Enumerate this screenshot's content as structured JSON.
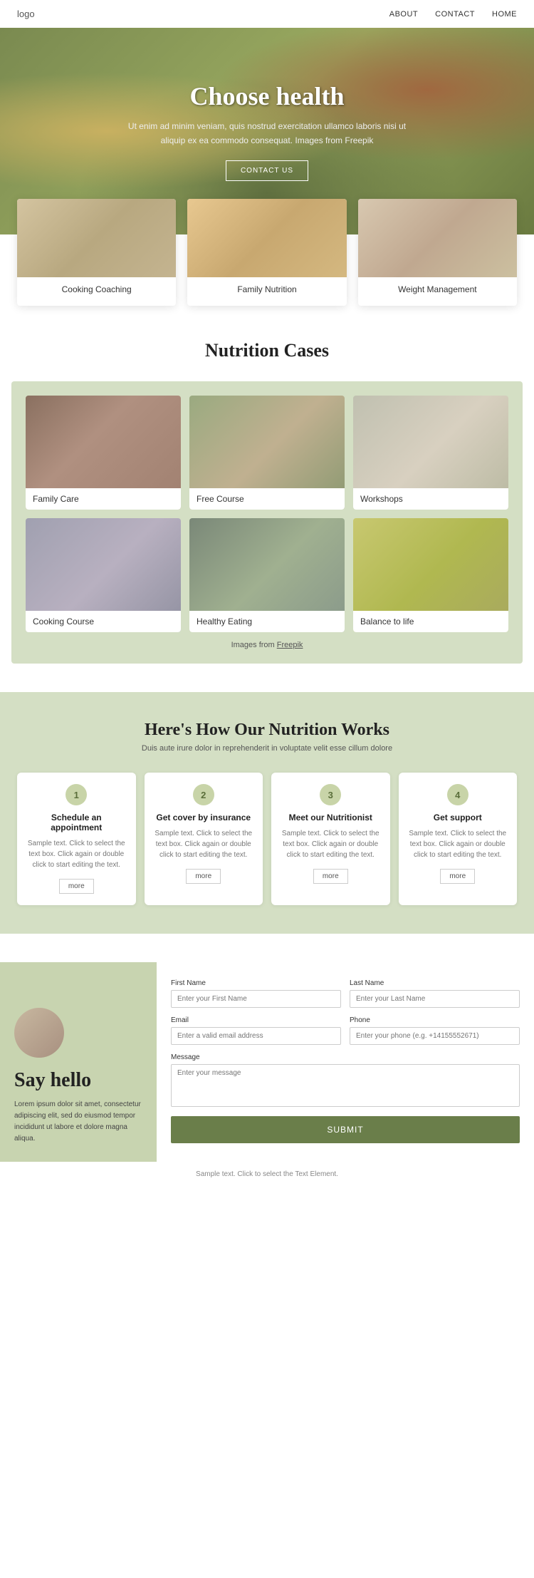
{
  "nav": {
    "logo": "logo",
    "links": [
      "ABOUT",
      "CONTACT",
      "HOME"
    ]
  },
  "hero": {
    "title": "Choose health",
    "description": "Ut enim ad minim veniam, quis nostrud exercitation ullamco laboris nisi ut aliquip ex ea commodo consequat. Images from Freepik",
    "cta_label": "CONTACT US"
  },
  "services": [
    {
      "label": "Cooking Coaching"
    },
    {
      "label": "Family Nutrition"
    },
    {
      "label": "Weight Management"
    }
  ],
  "nutrition": {
    "title": "Nutrition Cases",
    "cases": [
      {
        "label": "Family Care"
      },
      {
        "label": "Free Course"
      },
      {
        "label": "Workshops"
      },
      {
        "label": "Cooking Course"
      },
      {
        "label": "Healthy Eating"
      },
      {
        "label": "Balance to life"
      }
    ],
    "freepik_text": "Images from ",
    "freepik_link": "Freepik"
  },
  "how": {
    "title": "Here's How Our Nutrition Works",
    "subtitle": "Duis aute irure dolor in reprehenderit in voluptate velit esse cillum dolore",
    "steps": [
      {
        "num": "1",
        "title": "Schedule an appointment",
        "text": "Sample text. Click to select the text box. Click again or double click to start editing the text.",
        "more": "more"
      },
      {
        "num": "2",
        "title": "Get cover by insurance",
        "text": "Sample text. Click to select the text box. Click again or double click to start editing the text.",
        "more": "more"
      },
      {
        "num": "3",
        "title": "Meet our Nutritionist",
        "text": "Sample text. Click to select the text box. Click again or double click to start editing the text.",
        "more": "more"
      },
      {
        "num": "4",
        "title": "Get support",
        "text": "Sample text. Click to select the text box. Click again or double click to start editing the text.",
        "more": "more"
      }
    ]
  },
  "contact": {
    "greeting": "Say hello",
    "description": "Lorem ipsum dolor sit amet, consectetur adipiscing elit, sed do eiusmod tempor incididunt ut labore et dolore magna aliqua.",
    "form": {
      "first_name_label": "First Name",
      "first_name_placeholder": "Enter your First Name",
      "last_name_label": "Last Name",
      "last_name_placeholder": "Enter your Last Name",
      "email_label": "Email",
      "email_placeholder": "Enter a valid email address",
      "phone_label": "Phone",
      "phone_placeholder": "Enter your phone (e.g. +14155552671)",
      "message_label": "Message",
      "message_placeholder": "Enter your message",
      "submit_label": "SUBMIT"
    }
  },
  "footer": {
    "note": "Sample text. Click to select the Text Element."
  }
}
